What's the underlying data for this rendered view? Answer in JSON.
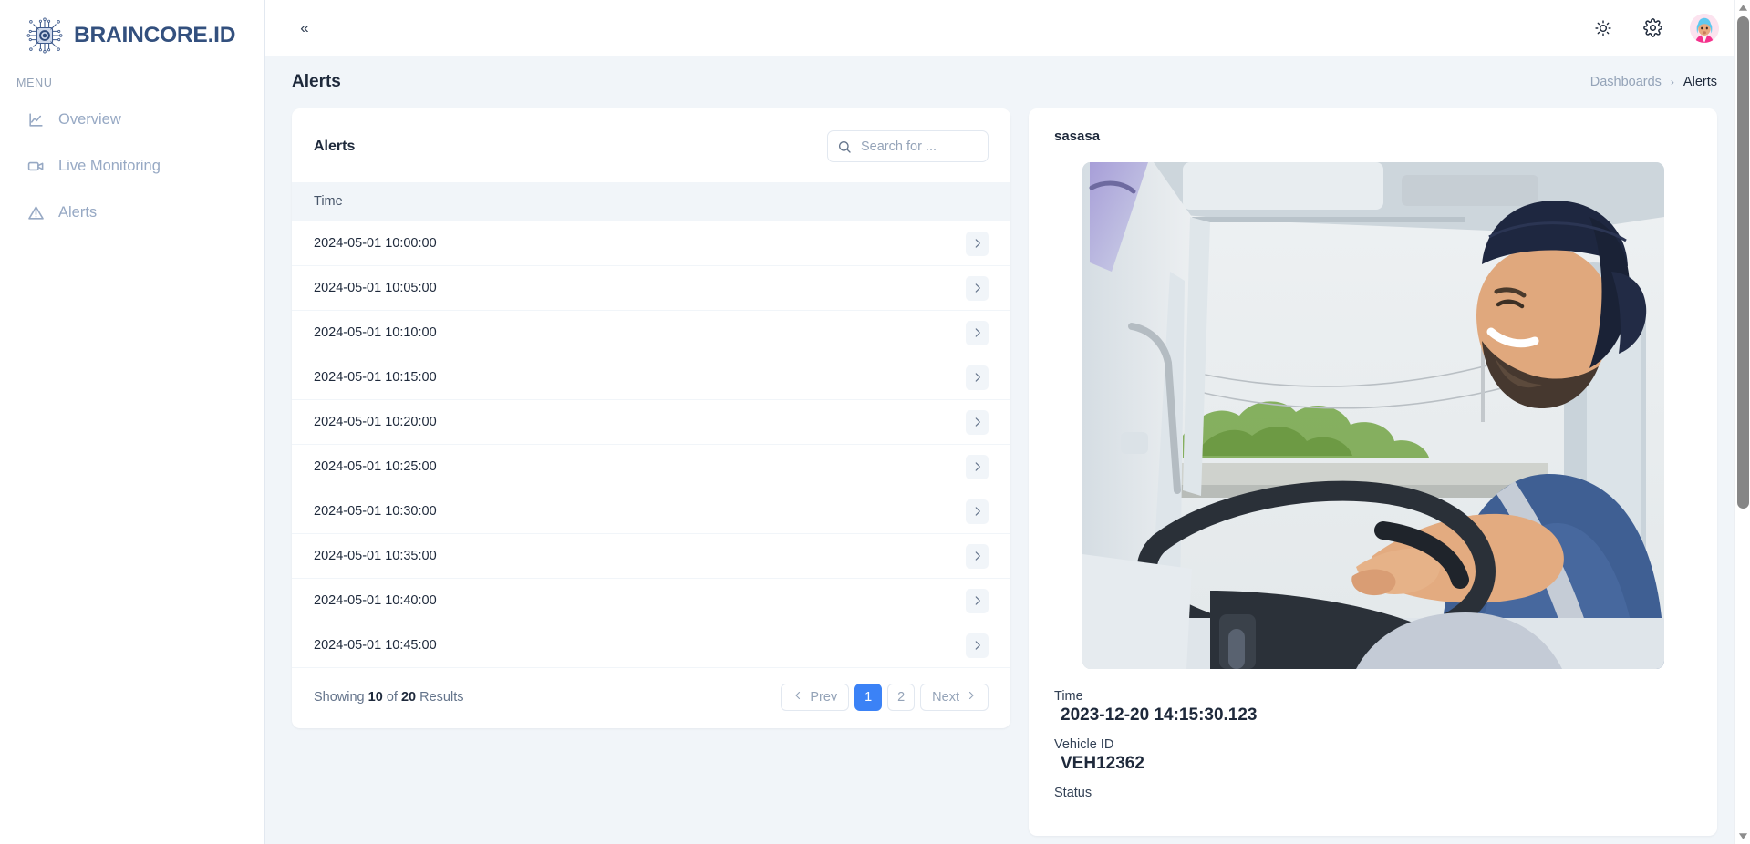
{
  "brand": {
    "name": "BRAINCORE.ID",
    "logo_icon": "cpu-chip-icon",
    "accent": "#33507e"
  },
  "sidebar": {
    "section_label": "MENU",
    "items": [
      {
        "label": "Overview",
        "icon": "line-chart-icon"
      },
      {
        "label": "Live Monitoring",
        "icon": "video-camera-icon"
      },
      {
        "label": "Alerts",
        "icon": "warning-triangle-icon"
      }
    ]
  },
  "topbar": {
    "collapse_icon": "chevron-double-left-icon",
    "collapse_label": "«",
    "theme_icon": "sun-icon",
    "settings_icon": "gear-icon",
    "avatar_icon": "user-avatar"
  },
  "page": {
    "title": "Alerts",
    "breadcrumb": {
      "parent": "Dashboards",
      "separator": "›",
      "current": "Alerts"
    }
  },
  "alerts_panel": {
    "title": "Alerts",
    "search": {
      "placeholder": "Search for ...",
      "value": "",
      "icon": "search-icon"
    },
    "columns": [
      "Time"
    ],
    "rows": [
      {
        "time": "2024-05-01 10:00:00",
        "action_icon": "chevron-right-icon"
      },
      {
        "time": "2024-05-01 10:05:00",
        "action_icon": "chevron-right-icon"
      },
      {
        "time": "2024-05-01 10:10:00",
        "action_icon": "chevron-right-icon"
      },
      {
        "time": "2024-05-01 10:15:00",
        "action_icon": "chevron-right-icon"
      },
      {
        "time": "2024-05-01 10:20:00",
        "action_icon": "chevron-right-icon"
      },
      {
        "time": "2024-05-01 10:25:00",
        "action_icon": "chevron-right-icon"
      },
      {
        "time": "2024-05-01 10:30:00",
        "action_icon": "chevron-right-icon"
      },
      {
        "time": "2024-05-01 10:35:00",
        "action_icon": "chevron-right-icon"
      },
      {
        "time": "2024-05-01 10:40:00",
        "action_icon": "chevron-right-icon"
      },
      {
        "time": "2024-05-01 10:45:00",
        "action_icon": "chevron-right-icon"
      }
    ],
    "pagination": {
      "showing_prefix": "Showing",
      "showing_count": "10",
      "showing_middle": "of",
      "total_count": "20",
      "showing_suffix": "Results",
      "prev_label": "Prev",
      "next_label": "Next",
      "pages": [
        "1",
        "2"
      ],
      "active_page": "1",
      "active_color": "#3b82f6"
    }
  },
  "detail_panel": {
    "title": "sasasa",
    "photo_alt": "truck-driver-photo",
    "fields": [
      {
        "label": "Time",
        "value": "2023-12-20 14:15:30.123"
      },
      {
        "label": "Vehicle ID",
        "value": "VEH12362"
      },
      {
        "label": "Status",
        "value": ""
      }
    ]
  }
}
